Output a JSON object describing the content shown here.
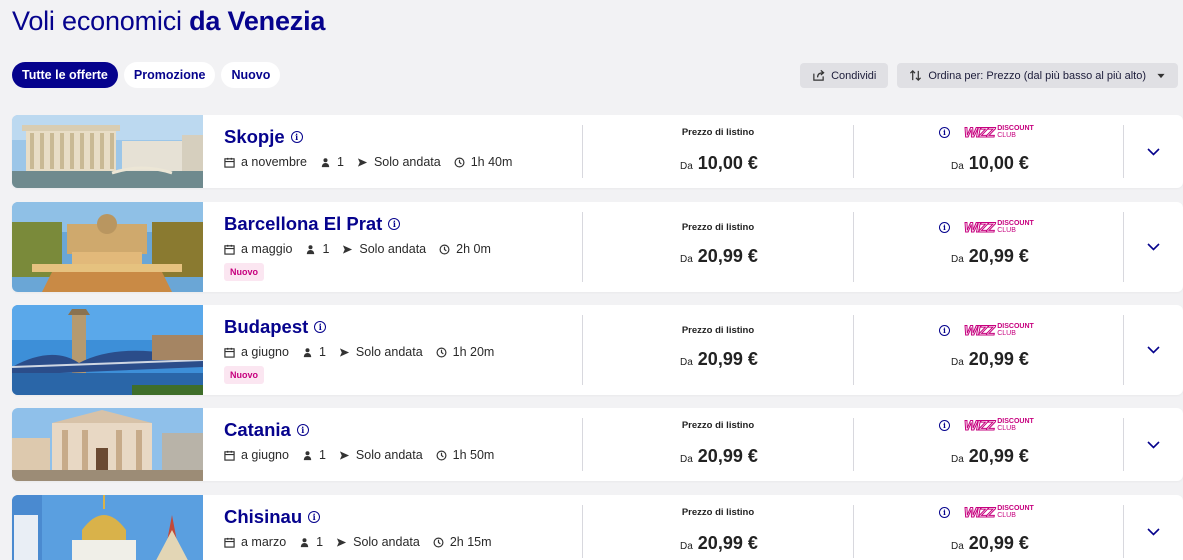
{
  "header": {
    "title_prefix": "Voli economici",
    "title_city": "da Venezia"
  },
  "filters": [
    {
      "label": "Tutte le offerte",
      "active": true
    },
    {
      "label": "Promozione",
      "active": false
    },
    {
      "label": "Nuovo",
      "active": false
    }
  ],
  "toolbar": {
    "share_label": "Condividi",
    "sort_label": "Ordina per: Prezzo (dal più basso al più alto)"
  },
  "common": {
    "price_label": "Prezzo di listino",
    "from_label": "Da",
    "discount_club_top": "DISCOUNT",
    "discount_club_bottom": "CLUB",
    "wizz_mark": "WIZZ"
  },
  "flights": [
    {
      "city": "Skopje",
      "month": "a novembre",
      "passengers": "1",
      "trip": "Solo andata",
      "duration": "1h 40m",
      "badge": "",
      "price": "10,00 €",
      "club_price": "10,00 €"
    },
    {
      "city": "Barcellona El Prat",
      "month": "a maggio",
      "passengers": "1",
      "trip": "Solo andata",
      "duration": "2h 0m",
      "badge": "Nuovo",
      "price": "20,99 €",
      "club_price": "20,99 €"
    },
    {
      "city": "Budapest",
      "month": "a giugno",
      "passengers": "1",
      "trip": "Solo andata",
      "duration": "1h 20m",
      "badge": "Nuovo",
      "price": "20,99 €",
      "club_price": "20,99 €"
    },
    {
      "city": "Catania",
      "month": "a giugno",
      "passengers": "1",
      "trip": "Solo andata",
      "duration": "1h 50m",
      "badge": "",
      "price": "20,99 €",
      "club_price": "20,99 €"
    },
    {
      "city": "Chisinau",
      "month": "a marzo",
      "passengers": "1",
      "trip": "Solo andata",
      "duration": "2h 15m",
      "badge": "",
      "price": "20,99 €",
      "club_price": "20,99 €"
    }
  ],
  "colors": {
    "brand_navy": "#06038d",
    "brand_pink": "#c6007e",
    "background": "#f2f2f4"
  }
}
